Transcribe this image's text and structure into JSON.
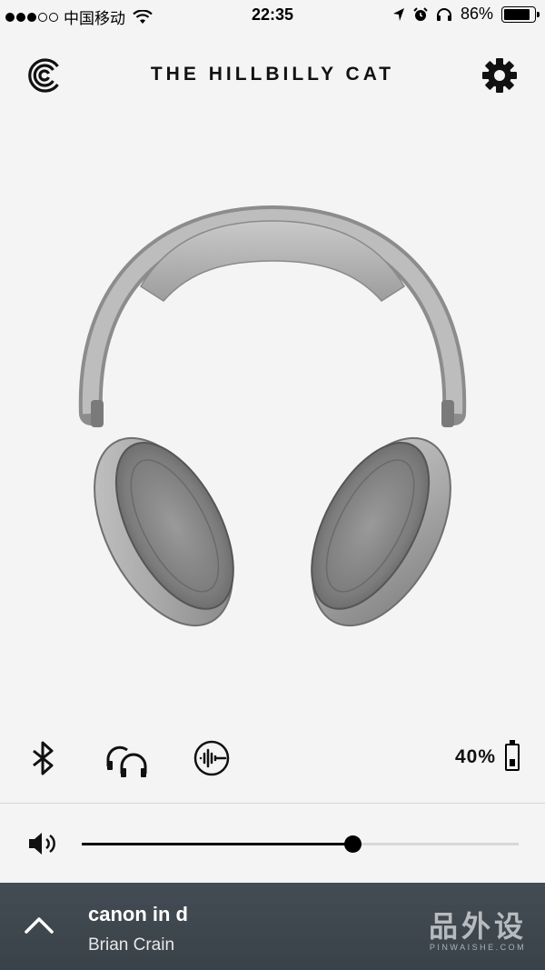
{
  "status_bar": {
    "carrier": "中国移动",
    "time": "22:35",
    "battery_percent": "86%",
    "battery_level": 0.86,
    "signal_bars_filled": 3,
    "signal_bars_total": 5
  },
  "header": {
    "title": "THE HILLBILLY CAT",
    "logo_icon": "bose-connect-logo-icon",
    "settings_icon": "gear-icon"
  },
  "product": {
    "image": "silver-headphones"
  },
  "controls": {
    "bluetooth_icon": "bluetooth-icon",
    "party_mode_icon": "headphones-pair-icon",
    "noise_control_icon": "noise-cancel-icon",
    "battery_level": "40%",
    "battery_fraction": 0.4
  },
  "volume": {
    "icon": "speaker-icon",
    "level": 0.62
  },
  "now_playing": {
    "title": "canon in d",
    "artist": "Brian Crain",
    "expand_icon": "chevron-up-icon"
  },
  "watermark": {
    "cn": "品外设",
    "en": "PINWAISHE.COM"
  },
  "colors": {
    "background": "#f4f4f4",
    "now_playing_bg": "#3e464d",
    "accent": "#000000"
  }
}
